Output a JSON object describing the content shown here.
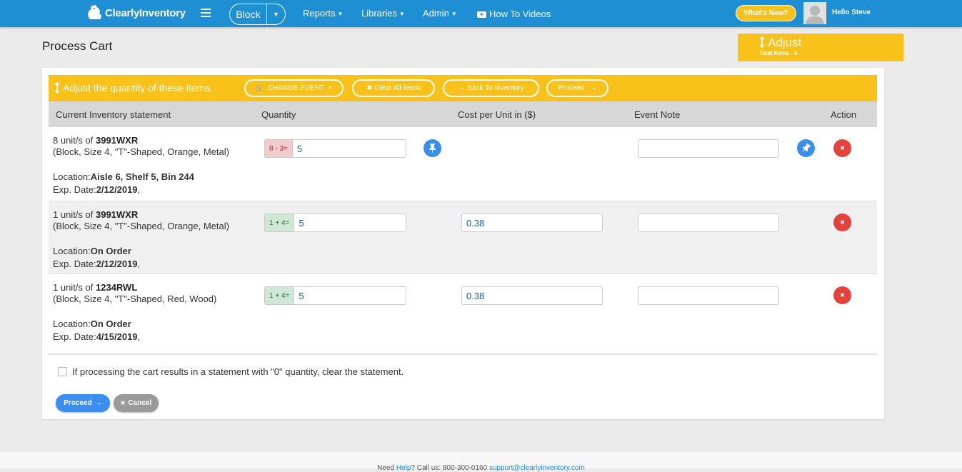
{
  "navbar": {
    "logo_text": "ClearlyInventory",
    "block_label": "Block",
    "menu": [
      {
        "label": "Reports"
      },
      {
        "label": "Libraries"
      },
      {
        "label": "Admin"
      }
    ],
    "how_to_videos": "How To Videos",
    "whats_new": "What's New?",
    "greeting": "Hello Steve"
  },
  "page": {
    "title": "Process Cart",
    "badge_title": "Adjust",
    "badge_subtitle": "Total Items - 3"
  },
  "card": {
    "header_title": "Adjust the quantity of these items.",
    "buttons": {
      "change_event": "CHANGE EVENT",
      "clear_all": "Clear All Items",
      "back": "Back To Inventory",
      "proceed": "Proceed"
    },
    "columns": [
      "Current Inventory statement",
      "Quantity",
      "Cost per Unit in ($)",
      "Event Note",
      "Action"
    ],
    "rows": [
      {
        "qty_text": "8 unit/s of ",
        "sku": "3991WXR",
        "desc": "(Block, Size 4, \"T\"-Shaped, Orange, Metal)",
        "location_label": "Location:",
        "location": "Aisle 6, Shelf 5, Bin 244",
        "exp_label": "Exp. Date:",
        "exp": "2/12/2019",
        "adjust": "8 - 3=",
        "quantity": "5",
        "cost": "",
        "note": ""
      },
      {
        "qty_text": "1 unit/s of ",
        "sku": "3991WXR",
        "desc": "(Block, Size 4, \"T\"-Shaped, Orange, Metal)",
        "location_label": "Location:",
        "location": "On Order",
        "exp_label": "Exp. Date:",
        "exp": "2/12/2019",
        "adjust": "1 + 4=",
        "quantity": "5",
        "cost": "0.38",
        "note": ""
      },
      {
        "qty_text": "1 unit/s of ",
        "sku": "1234RWL",
        "desc": "(Block, Size 4, \"T\"-Shaped, Red, Wood)",
        "location_label": "Location:",
        "location": "On Order",
        "exp_label": "Exp. Date:",
        "exp": "4/15/2019",
        "adjust": "1 + 4=",
        "quantity": "5",
        "cost": "0.38",
        "note": ""
      }
    ],
    "clear_zero_label": "If processing the cart results in a statement with \"0\" quantity, clear the statement.",
    "proceed_label": "Proceed",
    "cancel_label": "Cancel"
  },
  "footer": {
    "need": "Need ",
    "help": "Help",
    "call": "? Call us: 800-300-0160 ",
    "email": "support@clearlyinventory.com"
  },
  "colors": {
    "navbar": "#1d8fd2",
    "accent_yellow": "#f9c21b",
    "action_blue": "#3a8eed",
    "action_red": "#e8413c"
  }
}
